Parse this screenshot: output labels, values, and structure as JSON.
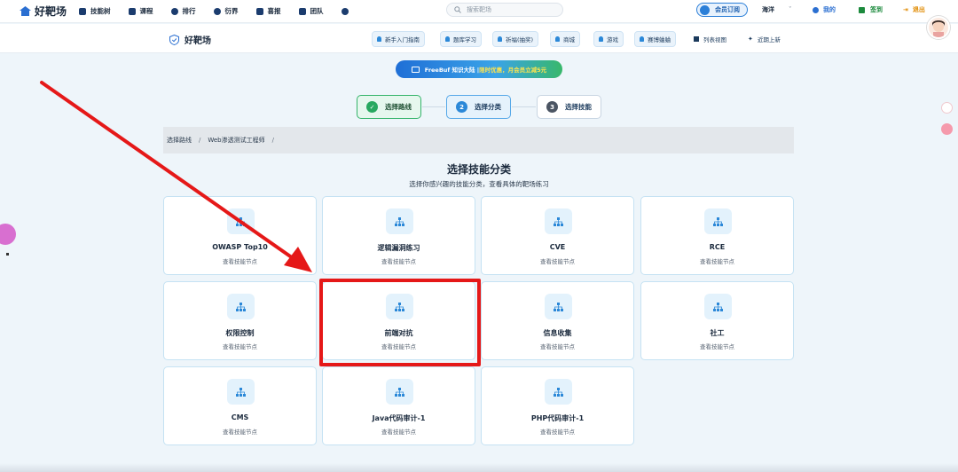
{
  "topnav": {
    "logo": "好靶场",
    "items": [
      "技能树",
      "课程",
      "排行",
      "衍界",
      "喜报",
      "团队"
    ],
    "search_placeholder": "搜索靶场",
    "vip": "会员订阅",
    "username": "海洋",
    "mine": "我的",
    "signin": "签到",
    "logout": "退出"
  },
  "subbar": {
    "brand": "好靶场",
    "tabs": [
      "新手入门指南",
      "题库学习",
      "祈福(抽奖)",
      "商城",
      "游戏",
      "赛博蛐蛐"
    ],
    "list_view": "列表视图",
    "recent": "近期上新"
  },
  "promo": {
    "prefix": "FreeBuf 知识大陆 | ",
    "highlight": "限时优惠，月会员立减5元"
  },
  "steps": [
    {
      "num": "✓",
      "label": "选择路线"
    },
    {
      "num": "2",
      "label": "选择分类"
    },
    {
      "num": "3",
      "label": "选择技能"
    }
  ],
  "breadcrumb": {
    "root": "选择路线",
    "path": "Web渗透测试工程师",
    "sep": "/"
  },
  "heading": {
    "title": "选择技能分类",
    "subtitle": "选择你感兴趣的技能分类，查看具体的靶场练习"
  },
  "cards": [
    {
      "name": "OWASP Top10",
      "desc": "查看技能节点"
    },
    {
      "name": "逻辑漏洞练习",
      "desc": "查看技能节点"
    },
    {
      "name": "CVE",
      "desc": "查看技能节点"
    },
    {
      "name": "RCE",
      "desc": "查看技能节点"
    },
    {
      "name": "权限控制",
      "desc": "查看技能节点"
    },
    {
      "name": "前端对抗",
      "desc": "查看技能节点"
    },
    {
      "name": "信息收集",
      "desc": "查看技能节点"
    },
    {
      "name": "社工",
      "desc": "查看技能节点"
    },
    {
      "name": "CMS",
      "desc": "查看技能节点"
    },
    {
      "name": "Java代码审计-1",
      "desc": "查看技能节点"
    },
    {
      "name": "PHP代码审计-1",
      "desc": "查看技能节点"
    }
  ],
  "colors": {
    "accent": "#2b88d8",
    "success": "#28a860",
    "annotation": "#e51818"
  }
}
